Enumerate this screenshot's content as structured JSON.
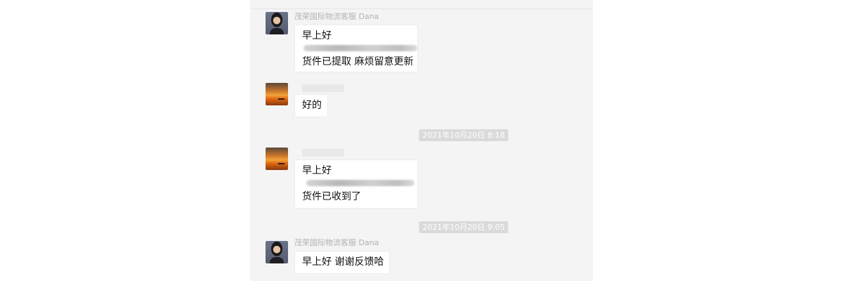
{
  "messages": [
    {
      "sender": "茂荣国际物流客服 Dana",
      "line1": "早上好",
      "line2": "货件已提取 麻烦留意更新"
    },
    {
      "sender": "",
      "text": "好的"
    },
    {
      "sender": "",
      "line1": "早上好",
      "line2": "货件已收到了"
    },
    {
      "sender": "茂荣国际物流客服 Dana",
      "text": "早上好  谢谢反馈哈"
    }
  ],
  "timestamps": [
    "2021年10月20日 8:18",
    "2021年10月20日 9:05"
  ],
  "icons": {
    "avatar_support": "person-avatar",
    "avatar_customer": "sunset-avatar"
  }
}
